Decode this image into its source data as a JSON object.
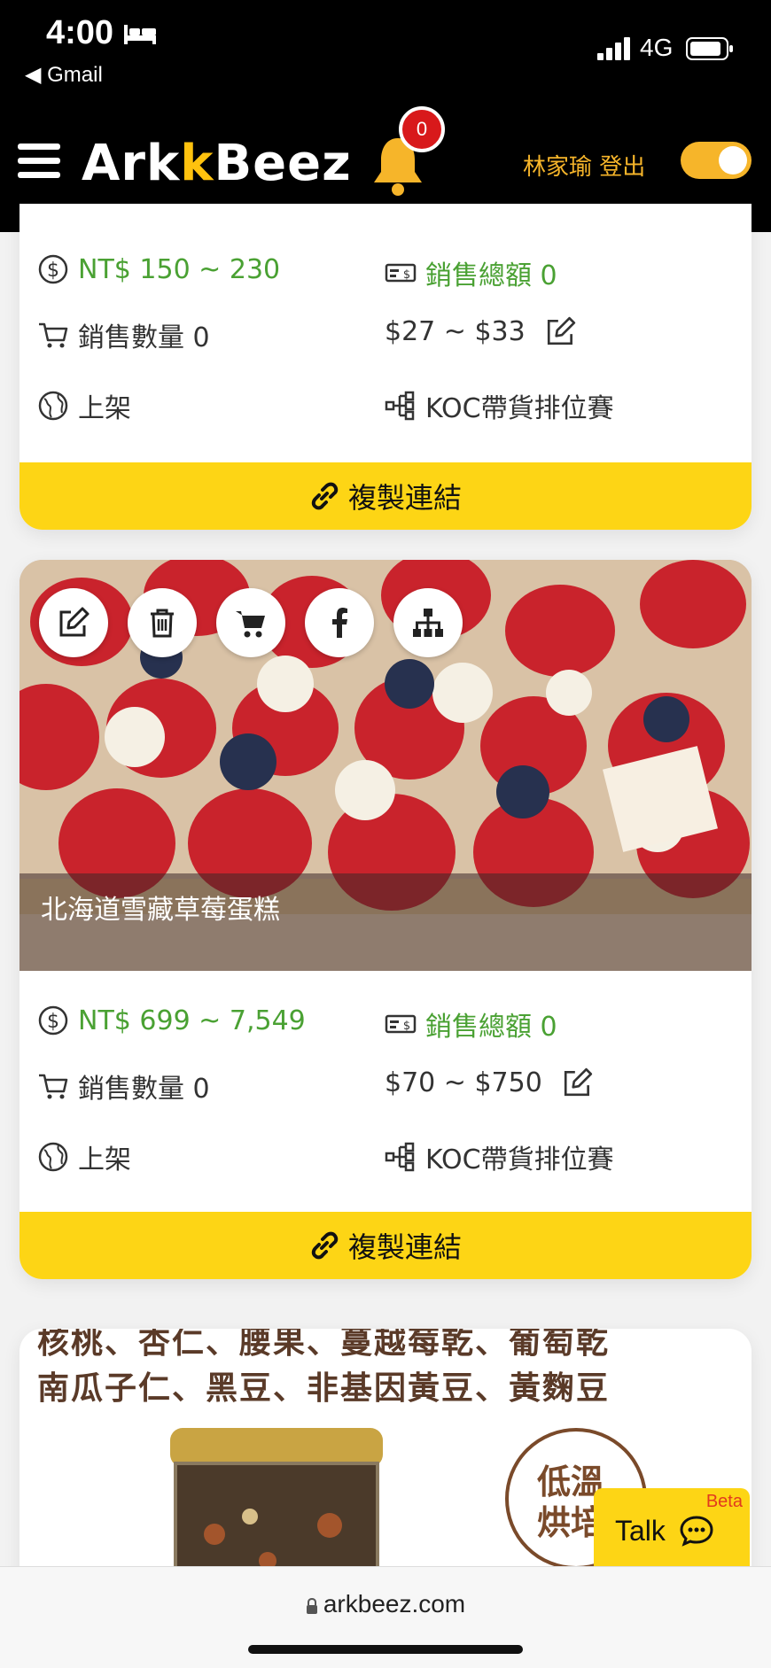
{
  "status_bar": {
    "time": "4:00",
    "back_label": "◀ Gmail",
    "network": "4G"
  },
  "header": {
    "logo_part1": "Ark",
    "logo_k": "k",
    "logo_part2": "Beez",
    "notification_count": "0",
    "user_name": "林家瑜 登出"
  },
  "products": [
    {
      "price_range": "NT$ 150 ~ 230",
      "total_sales_label": "銷售總額 0",
      "sales_qty_label": "銷售數量 0",
      "commission_range": "$27 ~ $33",
      "status": "上架",
      "campaign": "KOC帶貨排位賽",
      "copy_link_label": "複製連結"
    },
    {
      "title": "北海道雪藏草莓蛋糕",
      "price_range": "NT$ 699 ~ 7,549",
      "total_sales_label": "銷售總額 0",
      "sales_qty_label": "銷售數量 0",
      "commission_range": "$70 ~ $750",
      "status": "上架",
      "campaign": "KOC帶貨排位賽",
      "copy_link_label": "複製連結"
    },
    {
      "image_text_line1": "核桃、杏仁、腰果、蔓越莓乾、葡萄乾",
      "image_text_line2": "南瓜子仁、黑豆、非基因黃豆、黃麴豆",
      "stamp_text": "低溫烘培"
    }
  ],
  "talk_widget": {
    "label": "Talk",
    "badge": "Beta"
  },
  "browser": {
    "url": "arkbeez.com"
  },
  "colors": {
    "header_bg": "#000000",
    "accent_yellow": "#fdd515",
    "user_gold": "#f6b52a",
    "price_green": "#4aa133",
    "badge_red": "#d8191b"
  }
}
